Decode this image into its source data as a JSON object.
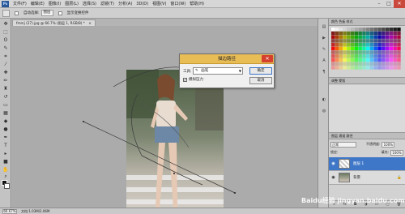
{
  "menubar": {
    "items": [
      "文件(F)",
      "编辑(E)",
      "图像(I)",
      "图层(L)",
      "选择(S)",
      "滤镜(T)",
      "分析(A)",
      "3D(D)",
      "视图(V)",
      "窗口(W)",
      "帮助(H)"
    ]
  },
  "options": {
    "option1_label": "自动选择:",
    "option1_value": "图层",
    "option2_label": "显示变换控件"
  },
  "document": {
    "tab_title": "fmmj (27).jpg @ 66.7% (图层 1, RGB/8) *"
  },
  "dialog": {
    "title": "描边路径",
    "tool_label": "工具:",
    "tool_value": "画笔",
    "simulate_label": "模拟压力",
    "simulate_checked": "✔",
    "ok_label": "确定",
    "cancel_label": "取消"
  },
  "panels": {
    "swatch_tabs": "颜色  色板  样式",
    "adjustments_tabs": "调整  蒙版",
    "layers_tabs": "图层  通道  路径",
    "blend_mode": "正常",
    "opacity_label": "不透明度:",
    "opacity_value": "100%",
    "lock_label": "锁定:",
    "fill_label": "填充:",
    "fill_value": "100%",
    "layers": [
      {
        "name": "图层 1"
      },
      {
        "name": "背景"
      }
    ]
  },
  "status": {
    "zoom": "66.67%",
    "doc_info": "文档:1.03M/2.06M"
  },
  "watermark": "Baidu经验 jingyan.baidu.com",
  "colors": {
    "accent": "#3f77c8",
    "dialog_title": "#e9bd56",
    "close": "#d43f2e"
  }
}
